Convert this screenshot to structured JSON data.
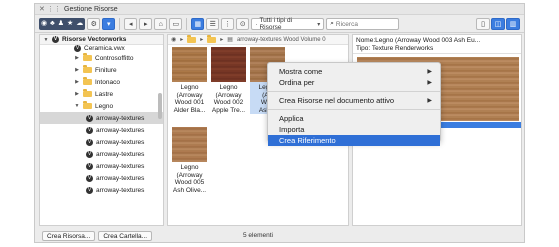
{
  "window": {
    "title": "Gestione Risorse"
  },
  "toolbar": {
    "filter_label": "Tutti i tipi di Risorse",
    "search_placeholder": "Ricerca"
  },
  "tree": {
    "header": "Risorse Vectorworks",
    "items": [
      {
        "label": "Ceramica.vwx",
        "type": "file"
      },
      {
        "label": "Controsoffitto",
        "type": "folder"
      },
      {
        "label": "Finiture",
        "type": "folder"
      },
      {
        "label": "Intonaco",
        "type": "folder"
      },
      {
        "label": "Lastre",
        "type": "folder"
      },
      {
        "label": "Legno",
        "type": "folder-open"
      },
      {
        "label": "arroway-textures",
        "type": "file"
      },
      {
        "label": "arroway-textures",
        "type": "file"
      },
      {
        "label": "arroway-textures",
        "type": "file"
      },
      {
        "label": "arroway-textures",
        "type": "file"
      },
      {
        "label": "arroway-textures",
        "type": "file"
      },
      {
        "label": "arroway-textures",
        "type": "file"
      },
      {
        "label": "arroway-textures",
        "type": "file"
      }
    ]
  },
  "browser": {
    "path": "arroway-textures Wood Volume 0",
    "thumbs": [
      {
        "line1": "Legno",
        "line2": "(Arroway",
        "line3": "Wood 001",
        "line4": "Alder Bla..."
      },
      {
        "line1": "Legno",
        "line2": "(Arroway",
        "line3": "Wood 002",
        "line4": "Apple Tre..."
      },
      {
        "line1": "Legno",
        "line2": "(Arr",
        "line3": "Woo",
        "line4": "Ash E"
      },
      {
        "line1": "",
        "line2": "",
        "line3": "",
        "line4": ""
      },
      {
        "line1": "Legno",
        "line2": "(Arroway",
        "line3": "Wood 005",
        "line4": "Ash Olive..."
      }
    ]
  },
  "preview": {
    "name": "Nome:Legno (Arroway Wood 003 Ash Eu...",
    "type": "Tipo: Texture Renderworks"
  },
  "context_menu": {
    "items": [
      {
        "label": "Mostra come",
        "submenu": true
      },
      {
        "label": "Ordina per",
        "submenu": true
      },
      {
        "label": "Crea Risorse nel documento attivo",
        "submenu": true
      },
      {
        "label": "Applica",
        "submenu": false
      },
      {
        "label": "Importa",
        "submenu": false
      },
      {
        "label": "Crea Riferimento",
        "submenu": false,
        "highlighted": true
      }
    ]
  },
  "footer": {
    "create_resource": "Crea Risorsa...",
    "create_folder": "Crea Cartella...",
    "count": "5 elementi"
  },
  "colors": {
    "accent": "#2f6fd6",
    "toolbar_dark": "#3f4f6b"
  }
}
